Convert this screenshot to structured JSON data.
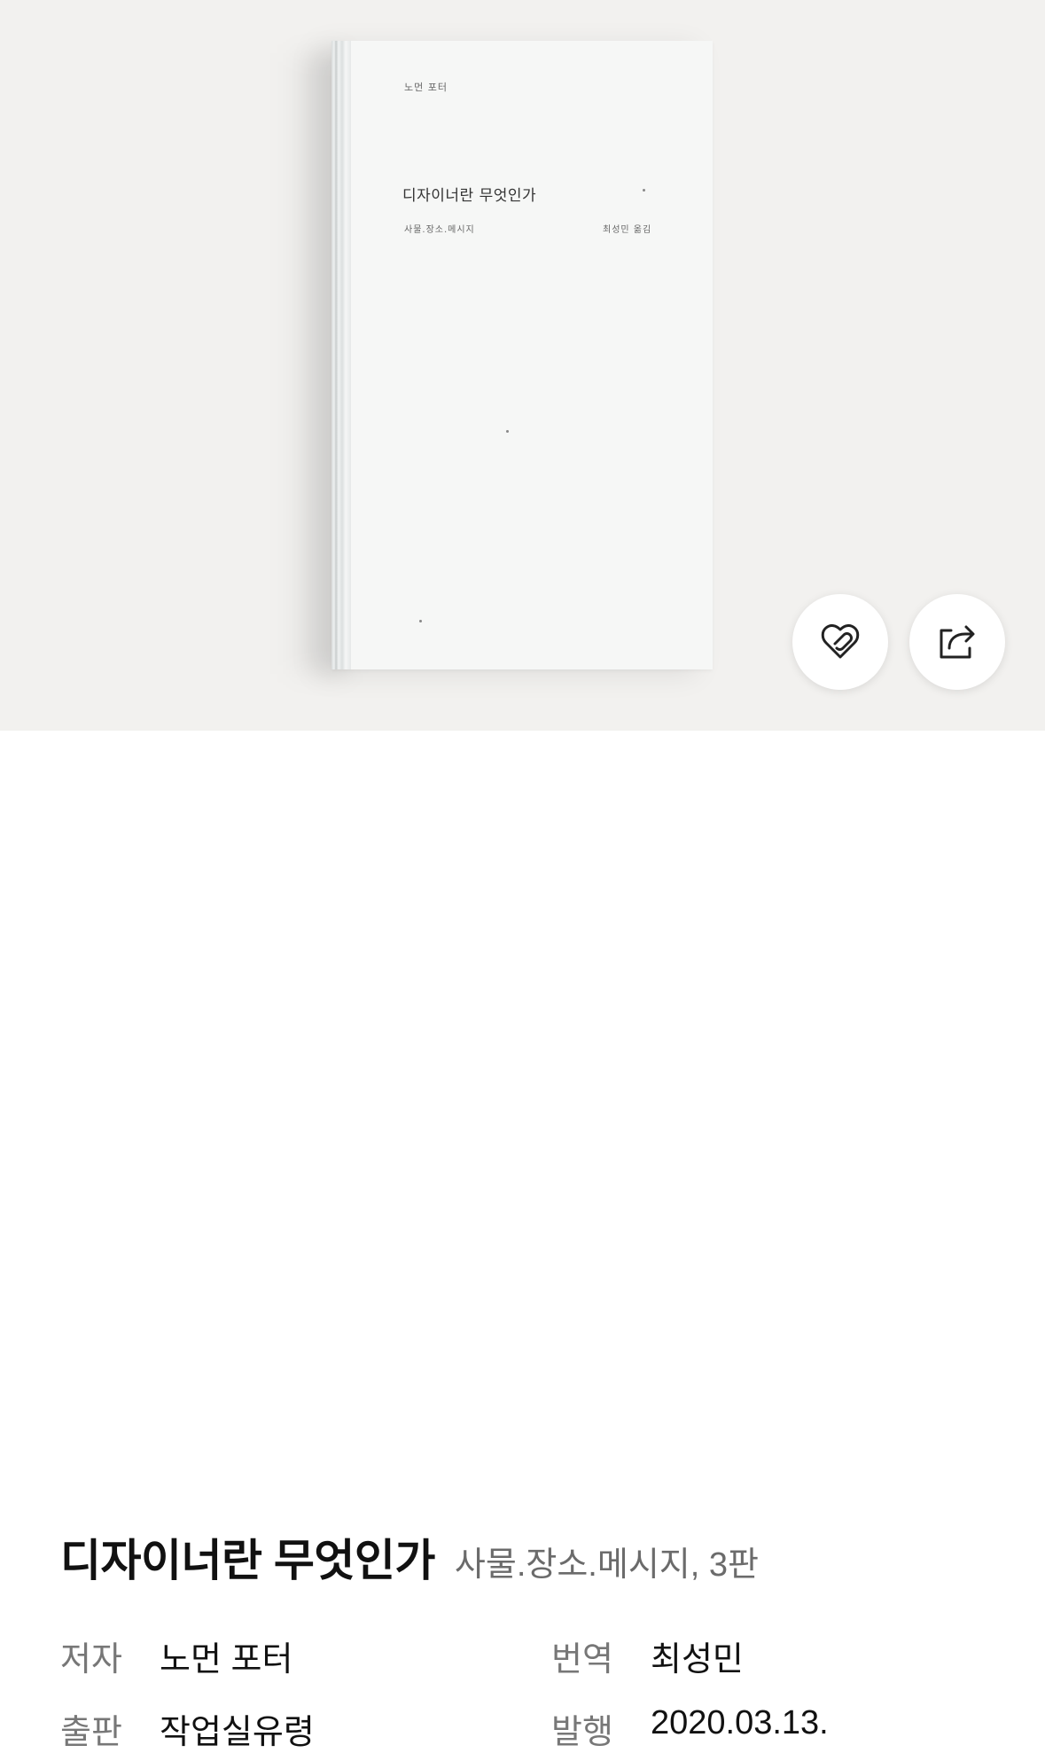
{
  "cover": {
    "author": "노먼 포터",
    "title": "디자이너란 무엇인가",
    "subtitle": "사물.장소.메시지",
    "translator": "최성민 옮김"
  },
  "actions": {
    "like_icon": "heart-link-icon",
    "share_icon": "share-icon"
  },
  "book": {
    "title": "디자이너란 무엇인가",
    "subtitle": "사물.장소.메시지, 3판"
  },
  "meta": {
    "author_label": "저자",
    "author_value": "노먼 포터",
    "translator_label": "번역",
    "translator_value": "최성민",
    "publisher_label": "출판",
    "publisher_value": "작업실유령",
    "date_label": "발행",
    "date_value": "2020.03.13."
  }
}
